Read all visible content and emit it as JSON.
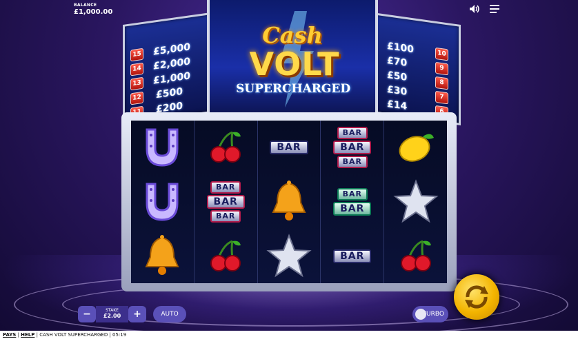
{
  "balance": {
    "label": "BALANCE",
    "value": "£1,000.00"
  },
  "left_paytable": [
    {
      "level": "15",
      "amount": "£5,000"
    },
    {
      "level": "14",
      "amount": "£2,000"
    },
    {
      "level": "13",
      "amount": "£1,000"
    },
    {
      "level": "12",
      "amount": "£500"
    },
    {
      "level": "11",
      "amount": "£200"
    }
  ],
  "right_paytable": [
    {
      "level": "10",
      "amount": "£100"
    },
    {
      "level": "9",
      "amount": "£70"
    },
    {
      "level": "8",
      "amount": "£50"
    },
    {
      "level": "7",
      "amount": "£30"
    },
    {
      "level": "6",
      "amount": "£14"
    }
  ],
  "logo": {
    "line1": "Cash",
    "line2": "VOLT",
    "line3": "SUPERCHARGED"
  },
  "reels": [
    [
      "horseshoe",
      "horseshoe",
      "bell"
    ],
    [
      "cherries",
      "triple-bar",
      "cherries"
    ],
    [
      "single-bar",
      "bell",
      "star"
    ],
    [
      "triple-bar",
      "double-bar",
      "single-bar"
    ],
    [
      "lemon",
      "star",
      "cherries"
    ]
  ],
  "bar_text": "BAR",
  "controls": {
    "minus": "−",
    "plus": "+",
    "stake_label": "STAKE",
    "stake_value": "£2.00",
    "auto": "AUTO",
    "turbo": "TURBO"
  },
  "footer": {
    "pays": "PAYS",
    "help": "HELP",
    "game": "CASH VOLT SUPERCHARGED",
    "time": "05:19"
  },
  "colors": {
    "accent": "#5a50b8",
    "spin": "#f3b400",
    "panel": "#1b2f95"
  }
}
